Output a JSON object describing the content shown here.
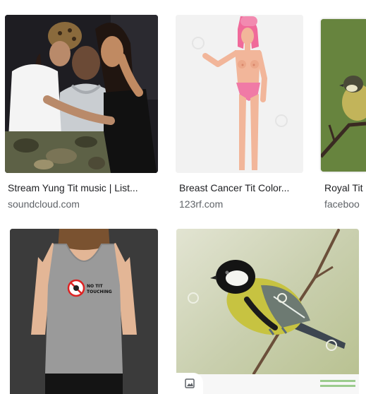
{
  "results": [
    {
      "title": "Stream Yung Tit music | List...",
      "source": "soundcloud.com"
    },
    {
      "title": "Breast Cancer Tit Color...",
      "source": "123rf.com"
    },
    {
      "title": "Royal Tit",
      "source": "faceboo"
    }
  ],
  "row2": {
    "tank_print_line1": "NO TIT",
    "tank_print_line2": "TOUCHING"
  },
  "icons": {
    "image_badge": "image-icon"
  },
  "colors": {
    "title_text": "#202124",
    "source_text": "#5f6368",
    "background": "#ffffff"
  }
}
